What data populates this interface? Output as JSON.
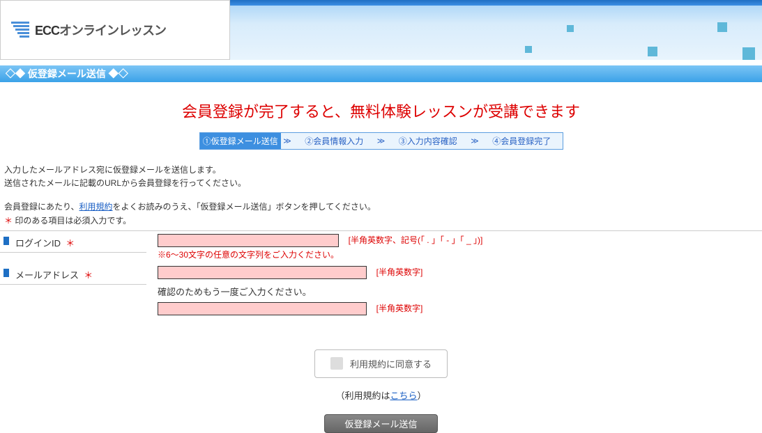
{
  "logo": {
    "brand": "ECC",
    "tagline": "オンラインレッスン"
  },
  "section_title": "◇◆ 仮登録メール送信 ◆◇",
  "main_heading": "会員登録が完了すると、無料体験レッスンが受講できます",
  "steps": {
    "s1": "①仮登録メール送信",
    "s2": "②会員情報入力",
    "s3": "③入力内容確認",
    "s4": "④会員登録完了",
    "sep": "≫"
  },
  "instructions": {
    "line1": "入力したメールアドレス宛に仮登録メールを送信します。",
    "line2": "送信されたメールに記載のURLから会員登録を行ってください。",
    "line3_pre": "会員登録にあたり、",
    "line3_link": "利用規約",
    "line3_post": "をよくお読みのうえ、「仮登録メール送信」ボタンを押してください。",
    "required_note": "  印のある項目は必須入力です。",
    "asterisk": "＊"
  },
  "form": {
    "login_id": {
      "label": "ログインID",
      "req": "＊",
      "hint": "[半角英数字、記号(「 . 」「 - 」「 _ 」)]",
      "sub_hint": "※6～30文字の任意の文字列をご入力ください。",
      "value": ""
    },
    "email": {
      "label": "メールアドレス",
      "req": "＊",
      "hint": "[半角英数字]",
      "confirm_text": "確認のためもう一度ご入力ください。",
      "confirm_hint": "[半角英数字]",
      "value": "",
      "confirm_value": ""
    }
  },
  "actions": {
    "agree_label": "利用規約に同意する",
    "terms_pre": "（利用規約は",
    "terms_link": "こちら",
    "terms_post": "）",
    "submit_label": "仮登録メール送信"
  }
}
